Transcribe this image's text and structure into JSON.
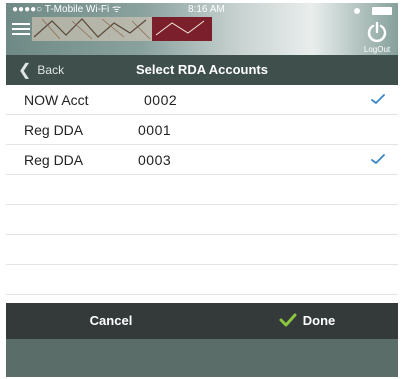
{
  "status_bar": {
    "carrier": "●●●●○ T-Mobile Wi-Fi ᯤ",
    "time": "8:16 AM"
  },
  "header": {
    "logout_label": "LogOut"
  },
  "navbar": {
    "back_label": "Back",
    "title": "Select RDA Accounts"
  },
  "accounts": [
    {
      "name": "NOW Acct",
      "number": "0002",
      "selected": true
    },
    {
      "name": "Reg DDA",
      "number": "0001",
      "selected": false
    },
    {
      "name": "Reg DDA",
      "number": "0003",
      "selected": true
    }
  ],
  "bottom_bar": {
    "cancel_label": "Cancel",
    "done_label": "Done"
  },
  "colors": {
    "check_blue": "#3a86c8",
    "done_green": "#8cc63f",
    "navbar": "#3f4f4c",
    "bottombar": "#333a39"
  }
}
